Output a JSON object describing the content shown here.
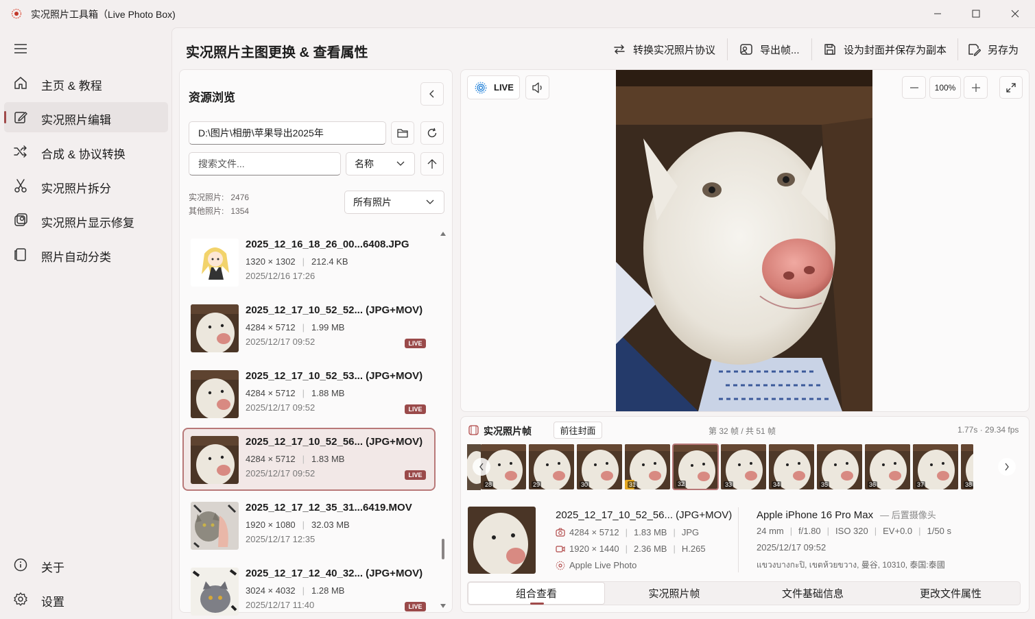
{
  "app": {
    "title": "实况照片工具箱（Live Photo Box)",
    "accent_color": "#a04a4a"
  },
  "window_controls": [
    "minimize-icon",
    "maximize-icon",
    "close-icon"
  ],
  "sidebar": {
    "items": [
      {
        "label": "主页 & 教程",
        "icon": "home-icon"
      },
      {
        "label": "实况照片编辑",
        "icon": "edit-icon",
        "active": true
      },
      {
        "label": "合成 & 协议转换",
        "icon": "shuffle-icon"
      },
      {
        "label": "实况照片拆分",
        "icon": "scissors-icon"
      },
      {
        "label": "实况照片显示修复",
        "icon": "photo-repair-icon"
      },
      {
        "label": "照片自动分类",
        "icon": "classify-icon"
      }
    ],
    "bottom": [
      {
        "label": "关于",
        "icon": "info-icon"
      },
      {
        "label": "设置",
        "icon": "gear-icon"
      }
    ]
  },
  "header": {
    "title": "实况照片主图更换 & 查看属性",
    "actions": [
      {
        "label": "转换实况照片协议",
        "icon": "convert-icon"
      },
      {
        "label": "导出帧...",
        "icon": "export-frame-icon"
      },
      {
        "label": "设为封面并保存为副本",
        "icon": "save-icon"
      },
      {
        "label": "另存为",
        "icon": "save-as-icon"
      }
    ]
  },
  "browser": {
    "title": "资源浏览",
    "path": "D:\\图片\\相册\\苹果导出2025年",
    "search_placeholder": "搜索文件...",
    "sort_by": "名称",
    "stats": {
      "live_label": "实况照片:",
      "live_count": "2476",
      "other_label": "其他照片:",
      "other_count": "1354"
    },
    "filter": "所有照片",
    "files": [
      {
        "name": "2025_12_16_18_26_00...6408.JPG",
        "dims": "1320 × 1302",
        "size": "212.4 KB",
        "date": "2025/12/16 17:26",
        "live": false,
        "thumb": "anime"
      },
      {
        "name": "2025_12_17_10_52_52... (JPG+MOV)",
        "dims": "4284 × 5712",
        "size": "1.99 MB",
        "date": "2025/12/17 09:52",
        "live": true,
        "thumb": "dog"
      },
      {
        "name": "2025_12_17_10_52_53... (JPG+MOV)",
        "dims": "4284 × 5712",
        "size": "1.88 MB",
        "date": "2025/12/17 09:52",
        "live": true,
        "thumb": "dog"
      },
      {
        "name": "2025_12_17_10_52_56... (JPG+MOV)",
        "dims": "4284 × 5712",
        "size": "1.83 MB",
        "date": "2025/12/17 09:52",
        "live": true,
        "thumb": "dog",
        "selected": true
      },
      {
        "name": "2025_12_17_12_35_31...6419.MOV",
        "dims": "1920 × 1080",
        "size": "32.03 MB",
        "date": "2025/12/17 12:35",
        "live": false,
        "thumb": "cat"
      },
      {
        "name": "2025_12_17_12_40_32... (JPG+MOV)",
        "dims": "3024 × 4032",
        "size": "1.28 MB",
        "date": "2025/12/17 11:40",
        "live": true,
        "thumb": "cat2"
      }
    ],
    "live_badge": "LIVE"
  },
  "viewer": {
    "live_label": "LIVE",
    "zoom": "100%"
  },
  "frames": {
    "title": "实况照片帧",
    "goto_cover": "前往封面",
    "position": "第 32 帧 / 共 51 帧",
    "timing": "1.77s · 29.34 fps",
    "numbers": [
      "28",
      "29",
      "30",
      "31",
      "32",
      "33",
      "34",
      "35",
      "36",
      "37",
      "38"
    ],
    "current": "32"
  },
  "details": {
    "filename": "2025_12_17_10_52_56... (JPG+MOV)",
    "photo": {
      "dims": "4284 × 5712",
      "size": "1.83 MB",
      "format": "JPG"
    },
    "video": {
      "dims": "1920 × 1440",
      "size": "2.36 MB",
      "codec": "H.265"
    },
    "type": "Apple Live Photo",
    "camera": "Apple iPhone 16 Pro Max",
    "lens": "— 后置摄像头",
    "focal": "24 mm",
    "aperture": "f/1.80",
    "iso": "ISO 320",
    "ev": "EV+0.0",
    "shutter": "1/50 s",
    "datetime": "2025/12/17 09:52",
    "location": "แขวงบางกะปิ, เขตห้วยขวาง, 曼谷, 10310, 泰国:泰國"
  },
  "tabs": [
    "组合查看",
    "实况照片帧",
    "文件基础信息",
    "更改文件属性"
  ]
}
